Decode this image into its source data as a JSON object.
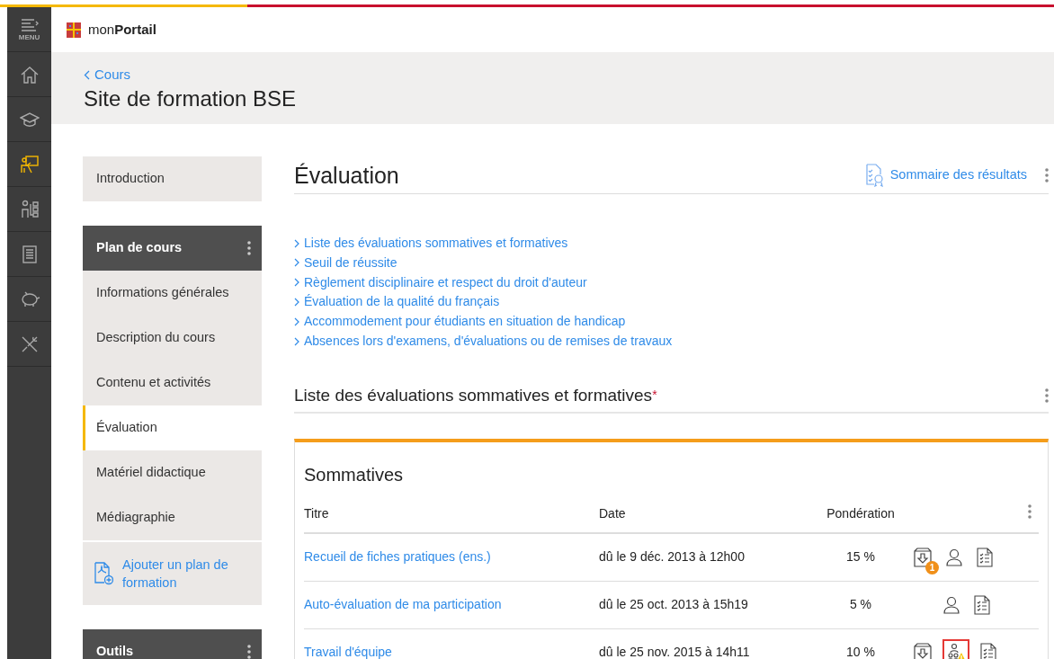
{
  "rail": [
    {
      "kind": "menu",
      "label": "MENU",
      "selected": false
    },
    {
      "kind": "home",
      "selected": false
    },
    {
      "kind": "cap",
      "selected": false
    },
    {
      "kind": "presenter",
      "selected": true
    },
    {
      "kind": "org",
      "selected": false
    },
    {
      "kind": "doc",
      "selected": false
    },
    {
      "kind": "piggy",
      "selected": false
    },
    {
      "kind": "tools",
      "selected": false
    }
  ],
  "header": {
    "brand": "mon**Portail**"
  },
  "breadcrumb": {
    "label": "Cours"
  },
  "page_title": "Site de formation BSE",
  "sidebar": {
    "intro": {
      "label": "Introduction",
      "selected": false
    },
    "groups": [
      {
        "title": "Plan de cours",
        "items": [
          {
            "label": "Informations générales",
            "selected": false
          },
          {
            "label": "Description du cours",
            "selected": false
          },
          {
            "label": "Contenu et activités",
            "selected": false
          },
          {
            "label": "Évaluation",
            "selected": true
          },
          {
            "label": "Matériel didactique",
            "selected": false
          },
          {
            "label": "Médiagraphie",
            "selected": false
          }
        ],
        "action": "Ajouter un plan de formation"
      },
      {
        "title": "Outils"
      }
    ]
  },
  "main": {
    "title": "Évaluation",
    "summary_link": "Sommaire des résultats",
    "links": [
      "Liste des évaluations sommatives et formatives",
      "Seuil de réussite",
      "Règlement disciplinaire et respect du droit d'auteur",
      "Évaluation de la qualité du français",
      "Accommodement pour étudiants en situation de handicap",
      "Absences lors d'examens, d'évaluations ou de remises de travaux"
    ],
    "section": {
      "title": "Liste des évaluations sommatives et formatives",
      "asterisk": "*",
      "card": {
        "heading": "Sommatives",
        "columns": [
          "Titre",
          "Date",
          "Pondération"
        ],
        "rows": [
          {
            "title": "Recueil de fiches pratiques (ens.)",
            "date": "dû le 9 déc. 2013 à 12h00",
            "weight": "15 %",
            "actions": [
              {
                "kind": "download",
                "badge": "1",
                "highlighted": false
              },
              {
                "kind": "person",
                "highlighted": false
              },
              {
                "kind": "checklist",
                "highlighted": false
              }
            ]
          },
          {
            "title": "Auto-évaluation de ma participation",
            "date": "dû le 25 oct. 2013 à 15h19",
            "weight": "5 %",
            "actions": [
              {
                "kind": "person",
                "highlighted": false
              },
              {
                "kind": "checklist",
                "highlighted": false
              }
            ]
          },
          {
            "title": "Travail d'équipe",
            "date": "dû le 25 nov. 2015 à 14h11",
            "weight": "10 %",
            "actions": [
              {
                "kind": "download",
                "highlighted": false
              },
              {
                "kind": "team-warning",
                "highlighted": true
              },
              {
                "kind": "checklist",
                "highlighted": false
              }
            ]
          }
        ]
      }
    }
  }
}
